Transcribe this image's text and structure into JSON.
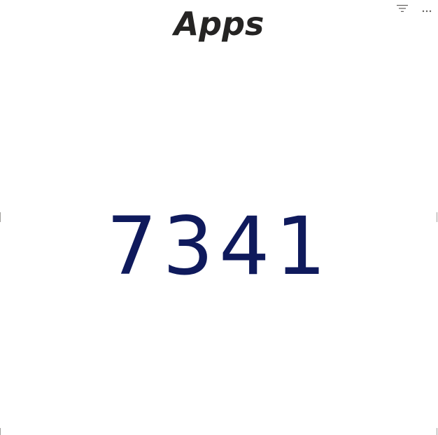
{
  "card": {
    "title": "Apps",
    "value": "7341"
  },
  "toolbar": {
    "icons": [
      "filter-icon",
      "more-options-icon"
    ]
  },
  "colors": {
    "title": "#252423",
    "value": "#0f1a5c",
    "icon": "#605e5c"
  }
}
